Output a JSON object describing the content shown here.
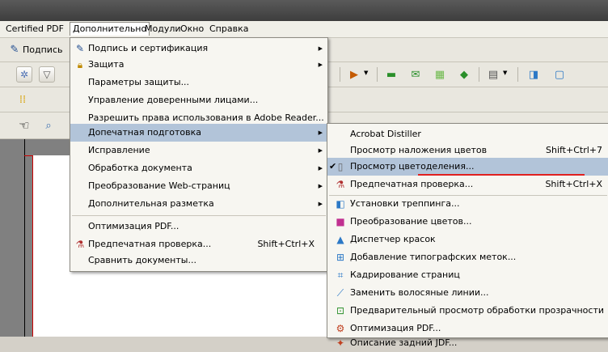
{
  "menubar": {
    "items": [
      {
        "label": "Certified PDF"
      },
      {
        "label": "Дополнительно"
      },
      {
        "label": "Модули"
      },
      {
        "label": "Окно"
      },
      {
        "label": "Справка"
      }
    ]
  },
  "toolbar": {
    "sign_label": "Подпись",
    "icons": [
      "settings-icon",
      "filter-icon",
      "hand-tool-icon",
      "zoom-tool-icon",
      "comment-icon",
      "mail-icon",
      "grid-icon",
      "diamond-icon",
      "layout-icon",
      "export-icon",
      "page-icon"
    ]
  },
  "main_menu": {
    "items": [
      {
        "label": "Подпись и сертификация",
        "submenu": true,
        "icon": "pen-icon"
      },
      {
        "label": "Защита",
        "submenu": true,
        "icon": "lock-icon"
      },
      {
        "label": "Параметры защиты..."
      },
      {
        "label": "Управление доверенными лицами..."
      },
      {
        "label": "Разрешить права использования в Adobe Reader..."
      },
      {
        "label": "Допечатная подготовка",
        "submenu": true
      },
      {
        "label": "Исправление",
        "submenu": true
      },
      {
        "label": "Обработка документа",
        "submenu": true
      },
      {
        "label": "Преобразование Web-страниц",
        "submenu": true
      },
      {
        "label": "Дополнительная разметка",
        "submenu": true
      },
      {
        "label": "Оптимизация PDF..."
      },
      {
        "label": "Предпечатная проверка...",
        "shortcut": "Shift+Ctrl+X",
        "icon": "preflight-icon"
      },
      {
        "label": "Сравнить документы..."
      }
    ]
  },
  "submenu": {
    "items": [
      {
        "label": "Acrobat Distiller"
      },
      {
        "label": "Просмотр наложения цветов",
        "shortcut": "Shift+Ctrl+7"
      },
      {
        "label": "Просмотр цветоделения...",
        "checked": true
      },
      {
        "label": "Предпечатная проверка...",
        "shortcut": "Shift+Ctrl+X"
      },
      {
        "label": "Установки треппинга..."
      },
      {
        "label": "Преобразование цветов..."
      },
      {
        "label": "Диспетчер красок"
      },
      {
        "label": "Добавление типографских меток..."
      },
      {
        "label": "Кадрирование страниц"
      },
      {
        "label": "Заменить волосяные линии..."
      },
      {
        "label": "Предварительный просмотр обработки прозрачности"
      },
      {
        "label": "Оптимизация PDF..."
      },
      {
        "label": "Описание задний JDF..."
      }
    ]
  },
  "colors": {
    "highlight": "#b2c4d9",
    "annotation_line": "#e02020",
    "menu_bg": "#f7f6f1"
  }
}
